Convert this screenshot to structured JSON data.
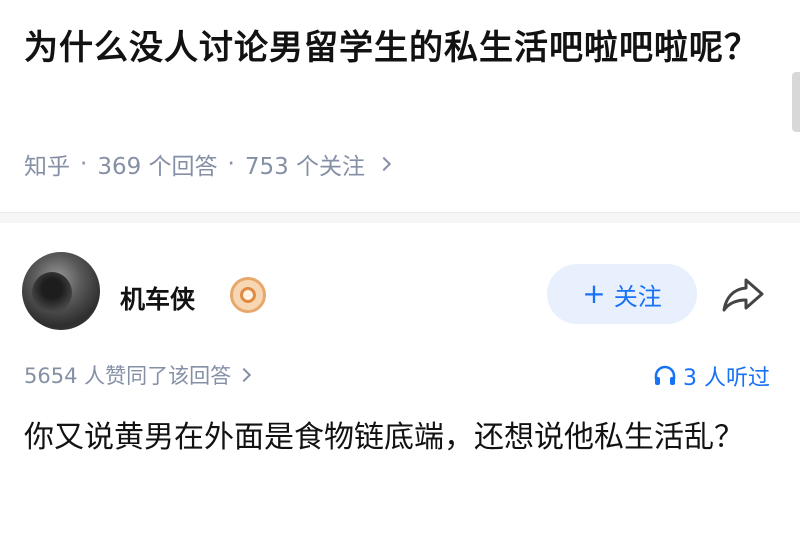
{
  "question": {
    "title": "为什么没人讨论男留学生的私生活吧啦吧啦呢？",
    "source": "知乎",
    "answers": "369 个回答",
    "follows": "753 个关注"
  },
  "answer": {
    "author_name": "机车侠",
    "follow_label": "关注",
    "votes_text": "5654 人赞同了该回答",
    "listen_text": "3 人听过",
    "content": "你又说黄男在外面是食物链底端，还想说他私生活乱？"
  },
  "colors": {
    "accent": "#1772f6",
    "muted": "#8590a6"
  },
  "icons": [
    "chevron-right-icon",
    "badge-icon",
    "share-icon",
    "headphone-icon"
  ]
}
